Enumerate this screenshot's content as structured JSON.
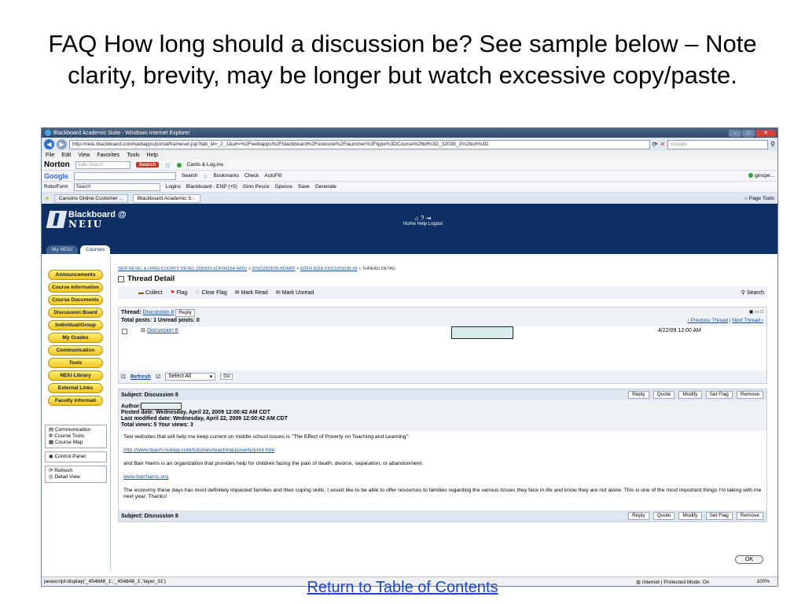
{
  "slide": {
    "title": "FAQ How long should a discussion be? See sample below – Note clarity, brevity, may be longer but watch excessive copy/paste.",
    "return_link": "Return to Table of Contents"
  },
  "browser": {
    "window_title": "Blackboard Academic Suite - Windows Internet Explorer",
    "address": "http://neiu.blackboard.com/webapps/portal/frameset.jsp?tab_id=_2_1&url=%2Fwebapps%2Fblackboard%2Fexecute%2Flauncher%3Ftype%3DCourse%26id%3D_32039_1%26url%3D",
    "search_placeholder": "Google",
    "menu": [
      "File",
      "Edit",
      "View",
      "Favorites",
      "Tools",
      "Help"
    ],
    "norton": {
      "brand": "Norton",
      "safe_search": "Safe Search",
      "search_btn": "Search",
      "cards": "Cards & Log-ins"
    },
    "google_bar": {
      "brand": "Google",
      "search": "Search",
      "bookmarks": "Bookmarks",
      "check": "Check",
      "autofill": "AutoFill",
      "user": "ginope..."
    },
    "roboform_bar": {
      "roboform": "RoboForm",
      "search": "Search",
      "logins": "Logins",
      "blackboard": "Blackboard - ENP (+5)",
      "gino": "Gino Pesce",
      "gpesce": "Gpesce",
      "save": "Save",
      "generate": "Generate"
    },
    "tabs": [
      "Carsons Online Customer ...",
      "Blackboard Academic S..."
    ],
    "tab_tools": [
      "Page",
      "Tools"
    ],
    "status_left": "javascript:display('_454848_1','_454848_1','layer_31')",
    "status_zone": "Internet | Protected Mode: On",
    "status_zoom": "100%"
  },
  "bb": {
    "brand": "Blackboard",
    "at": "@",
    "school": "NEIU",
    "top_links": "Home  Help  Logout",
    "tabs": [
      "My NEIU",
      "Courses"
    ],
    "course_menu": [
      "Announcements",
      "Course Information",
      "Course Documents",
      "Discussion Board",
      "Individual/Group",
      "My Grades",
      "Communication",
      "Tools",
      "NEIU Library",
      "External Links",
      "Faculty Informati"
    ],
    "tool_links_1": [
      "Communication",
      "Course Tools",
      "Course Map"
    ],
    "tool_links_2": [
      "Control Panel"
    ],
    "tool_links_3": [
      "Refresh",
      "Detail View"
    ]
  },
  "thread": {
    "breadcrumb_1": "SEM DEVEL & LRNG:COGNTV DEVEL (200920-EDFN415A-W01)",
    "breadcrumb_2": "DISCUSSION BOARD",
    "breadcrumb_3": "EDFN 415A DISCUSSION #8",
    "breadcrumb_4": "THREAD DETAIL",
    "page_title": "Thread Detail",
    "actions": [
      "Collect",
      "Flag",
      "Clear Flag",
      "Mark Read",
      "Mark Unread"
    ],
    "search": "Search",
    "thread_label": "Thread:",
    "thread_name": "Discussion 8",
    "reply": "Reply",
    "totals": "Total posts: 1  Unread posts: 0",
    "prev_thread": "‹ Previous Thread",
    "next_thread": "Next Thread ›",
    "row_link": "Discussion 8",
    "row_date": "4/22/09 12:00 AM",
    "refresh": "Refresh",
    "select_all": "Select All",
    "go": "Go"
  },
  "message": {
    "subject": "Subject: Discussion 8",
    "buttons": [
      "Reply",
      "Quote",
      "Modify",
      "Set Flag",
      "Remove"
    ],
    "author_label": "Author:",
    "posted": "Posted date: Wednesday, April 22, 2009 12:00:42 AM CDT",
    "modified": "Last modified date: Wednesday, April 22, 2009 12:00:42 AM CDT",
    "views": "Total views: 5  Your views: 3",
    "p1": "Two websites that will help me keep current on middle school issues is \"The Effect of Poverty on Teaching and Learning\":",
    "link1": "http://www.teach-nology.com/tutorials/teaching/poverty/print.htm",
    "p2": "and Barr Harris is an organization that provides help for children facing the pain of death, divorce, separation, or abandonment.",
    "link2": "www.barrharris.org",
    "p3": "The economy these days has most definitely impacted families and their coping skills.  I would like to be able to offer resources to families regarding the various losses they face in life and know they are not alone.  This is one of the most important things I'm taking with me next year.  Thanks!",
    "subject_footer": "Subject: Discussion 8",
    "ok": "OK"
  }
}
